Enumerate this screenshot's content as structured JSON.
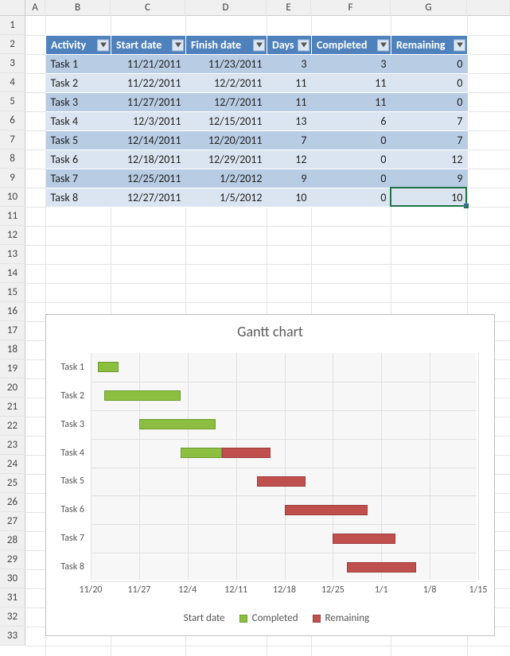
{
  "columns": [
    "A",
    "B",
    "C",
    "D",
    "E",
    "F",
    "G"
  ],
  "col_rest_label": "",
  "row_count": 33,
  "table": {
    "headers": {
      "activity": "Activity",
      "start": "Start date",
      "finish": "Finish date",
      "days": "Days",
      "completed": "Completed",
      "remaining": "Remaining"
    },
    "rows": [
      {
        "activity": "Task 1",
        "start": "11/21/2011",
        "finish": "11/23/2011",
        "days": 3,
        "completed": 3,
        "remaining": 0
      },
      {
        "activity": "Task 2",
        "start": "11/22/2011",
        "finish": "12/2/2011",
        "days": 11,
        "completed": 11,
        "remaining": 0
      },
      {
        "activity": "Task 3",
        "start": "11/27/2011",
        "finish": "12/7/2011",
        "days": 11,
        "completed": 11,
        "remaining": 0
      },
      {
        "activity": "Task 4",
        "start": "12/3/2011",
        "finish": "12/15/2011",
        "days": 13,
        "completed": 6,
        "remaining": 7
      },
      {
        "activity": "Task 5",
        "start": "12/14/2011",
        "finish": "12/20/2011",
        "days": 7,
        "completed": 0,
        "remaining": 7
      },
      {
        "activity": "Task 6",
        "start": "12/18/2011",
        "finish": "12/29/2011",
        "days": 12,
        "completed": 0,
        "remaining": 12
      },
      {
        "activity": "Task 7",
        "start": "12/25/2011",
        "finish": "1/2/2012",
        "days": 9,
        "completed": 0,
        "remaining": 9
      },
      {
        "activity": "Task 8",
        "start": "12/27/2011",
        "finish": "1/5/2012",
        "days": 10,
        "completed": 0,
        "remaining": 10
      }
    ]
  },
  "chart_data": {
    "type": "bar",
    "orientation": "horizontal-stacked",
    "title": "Gantt chart",
    "x_axis": {
      "ticks": [
        "11/20",
        "11/27",
        "12/4",
        "12/11",
        "12/18",
        "12/25",
        "1/1",
        "1/8",
        "1/15"
      ],
      "min": "11/20/2011",
      "max": "1/15/2012",
      "tick_interval_days": 7
    },
    "categories": [
      "Task 1",
      "Task 2",
      "Task 3",
      "Task 4",
      "Task 5",
      "Task 6",
      "Task 7",
      "Task 8"
    ],
    "series": [
      {
        "name": "Start date",
        "role": "offset",
        "color": "transparent",
        "values": [
          1,
          2,
          7,
          13,
          24,
          28,
          35,
          37
        ]
      },
      {
        "name": "Completed",
        "color": "#8cbf40",
        "values": [
          3,
          11,
          11,
          6,
          0,
          0,
          0,
          0
        ]
      },
      {
        "name": "Remaining",
        "color": "#c0504d",
        "values": [
          0,
          0,
          0,
          7,
          7,
          12,
          9,
          10
        ]
      }
    ],
    "legend": [
      "Start date",
      "Completed",
      "Remaining"
    ]
  },
  "selection_cell": "G10"
}
